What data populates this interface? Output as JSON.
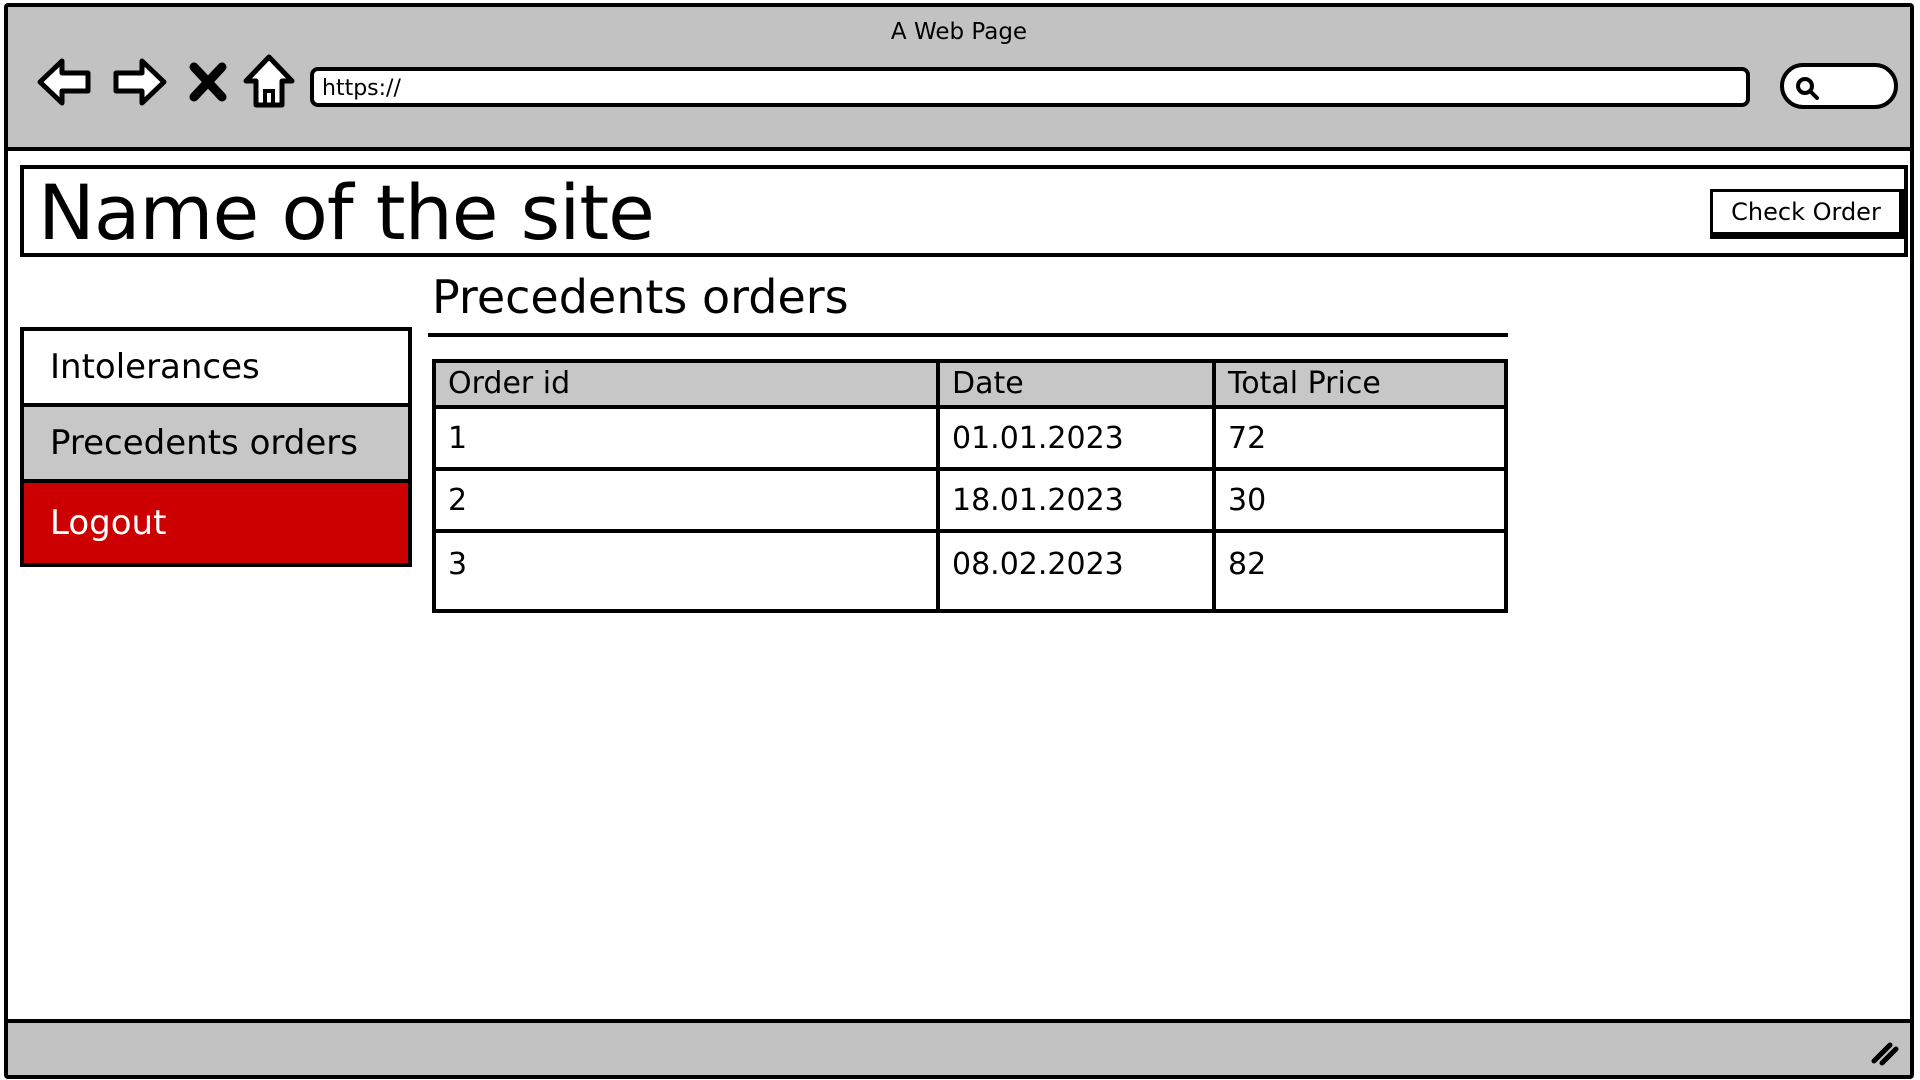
{
  "browser": {
    "title": "A Web Page",
    "url": "https://"
  },
  "header": {
    "site_name": "Name of the site",
    "check_order_label": "Check Order"
  },
  "main": {
    "heading": "Precedents orders",
    "table": {
      "columns": [
        "Order id",
        "Date",
        "Total Price"
      ],
      "rows": [
        {
          "id": "1",
          "date": "01.01.2023",
          "total": "72"
        },
        {
          "id": "2",
          "date": "18.01.2023",
          "total": "30"
        },
        {
          "id": "3",
          "date": "08.02.2023",
          "total": "82"
        }
      ]
    }
  },
  "sidebar": {
    "items": [
      {
        "label": "Intolerances"
      },
      {
        "label": "Precedents orders"
      },
      {
        "label": "Logout"
      }
    ]
  },
  "colors": {
    "chrome_gray": "#c2c2c2",
    "active_item": "#c7c7c7",
    "logout_red": "#cc0000"
  }
}
